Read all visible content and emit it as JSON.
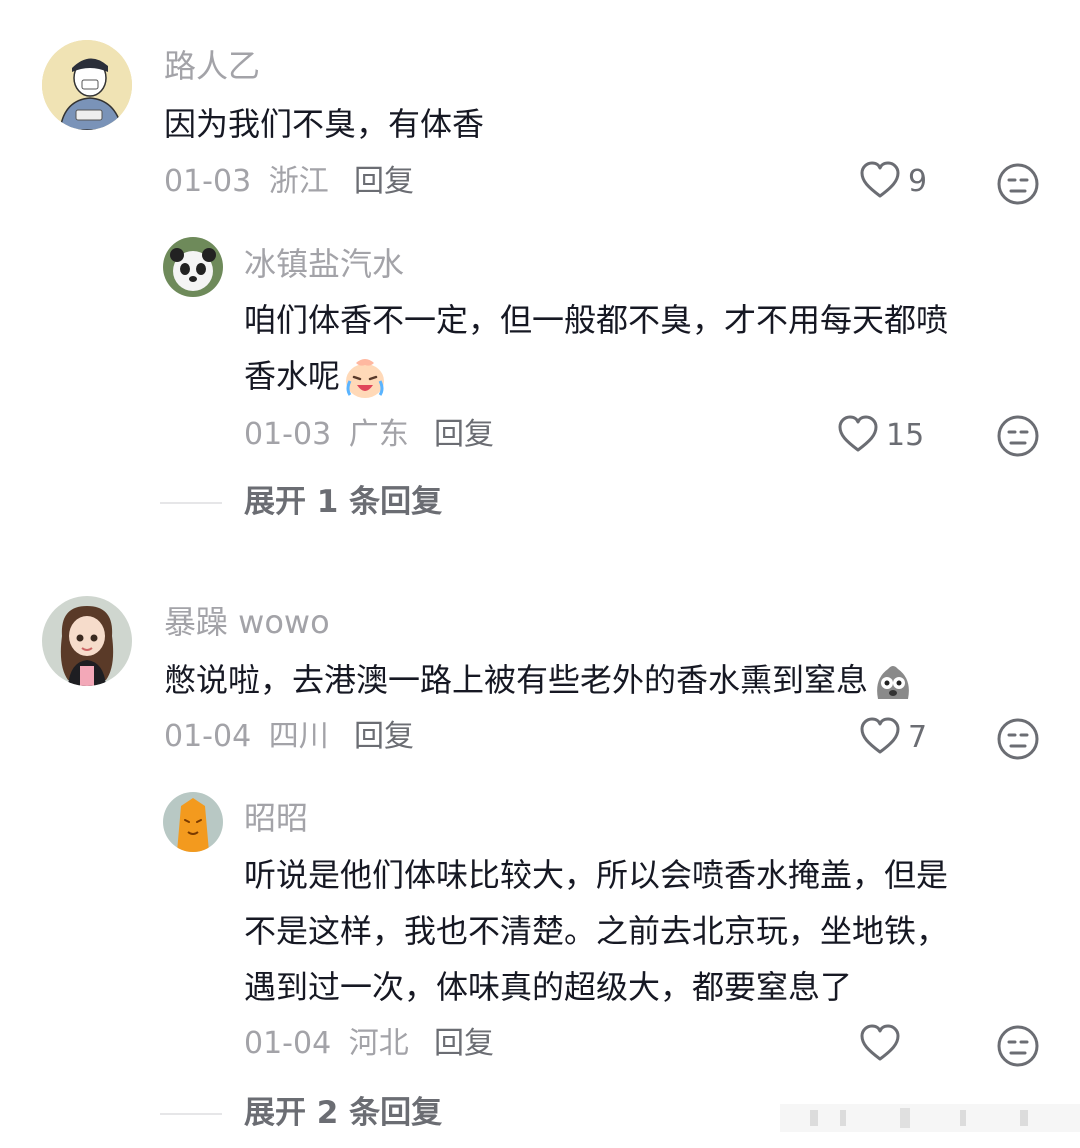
{
  "comments": [
    {
      "username": "路人乙",
      "text": "因为我们不臭，有体香",
      "date": "01-03",
      "location": "浙江",
      "reply_label": "回复",
      "likes": "9",
      "replies": [
        {
          "username": "冰镇盐汽水",
          "lines": [
            "咱们体香不一定，但一般都不臭，才不用每天都喷",
            "香水呢"
          ],
          "emoji": "crying-laughing-emoji",
          "date": "01-03",
          "location": "广东",
          "reply_label": "回复",
          "likes": "15"
        }
      ],
      "expand_label": "展开 1 条回复"
    },
    {
      "username": "暴躁 wowo",
      "text": "憋说啦，去港澳一路上被有些老外的香水熏到窒息",
      "emoji": "dazed-emoji",
      "date": "01-04",
      "location": "四川",
      "reply_label": "回复",
      "likes": "7",
      "replies": [
        {
          "username": "昭昭",
          "lines": [
            "听说是他们体味比较大，所以会喷香水掩盖，但是",
            "不是这样，我也不清楚。之前去北京玩，坐地铁，",
            "遇到过一次，体味真的超级大，都要窒息了"
          ],
          "date": "01-04",
          "location": "河北",
          "reply_label": "回复",
          "likes": ""
        }
      ],
      "expand_label": "展开 2 条回复"
    }
  ],
  "icons": {
    "like": "heart-outline-icon",
    "dislike": "neutral-face-icon"
  },
  "colors": {
    "text": "#161823",
    "secondary": "#a3a3a8",
    "action": "#6b6d73"
  }
}
